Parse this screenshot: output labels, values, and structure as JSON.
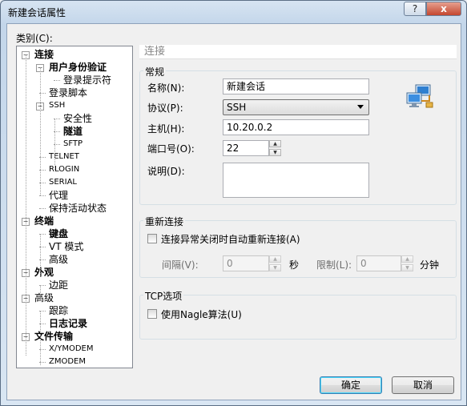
{
  "window": {
    "title": "新建会话属性",
    "help_btn": "?",
    "close_btn": "x"
  },
  "category_label": "类别(C):",
  "tree": [
    {
      "label": "连接",
      "bold": true,
      "expander": "−"
    },
    {
      "label": "用户身份验证",
      "bold": true,
      "expander": "−"
    },
    {
      "label": "登录提示符"
    },
    {
      "label": "登录脚本"
    },
    {
      "label": "SSH",
      "expander": "−",
      "small": true
    },
    {
      "label": "安全性"
    },
    {
      "label": "隧道",
      "bold": true
    },
    {
      "label": "SFTP",
      "small": true
    },
    {
      "label": "TELNET",
      "small": true
    },
    {
      "label": "RLOGIN",
      "small": true
    },
    {
      "label": "SERIAL",
      "small": true
    },
    {
      "label": "代理"
    },
    {
      "label": "保持活动状态"
    },
    {
      "label": "终端",
      "bold": true,
      "expander": "−"
    },
    {
      "label": "键盘",
      "bold": true
    },
    {
      "label": "VT 模式"
    },
    {
      "label": "高级"
    },
    {
      "label": "外观",
      "bold": true,
      "expander": "−"
    },
    {
      "label": "边距"
    },
    {
      "label": "高级",
      "expander": "−"
    },
    {
      "label": "跟踪"
    },
    {
      "label": "日志记录",
      "bold": true
    },
    {
      "label": "文件传输",
      "bold": true,
      "expander": "−"
    },
    {
      "label": "X/YMODEM",
      "small": true
    },
    {
      "label": "ZMODEM",
      "small": true
    }
  ],
  "panel": {
    "header": "连接",
    "general": {
      "title": "常规",
      "name_label": "名称(N):",
      "name_value": "新建会话",
      "protocol_label": "协议(P):",
      "protocol_value": "SSH",
      "host_label": "主机(H):",
      "host_value": "10.20.0.2",
      "port_label": "端口号(O):",
      "port_value": "22",
      "desc_label": "说明(D):",
      "desc_value": ""
    },
    "reconnect": {
      "title": "重新连接",
      "checkbox_label": "连接异常关闭时自动重新连接(A)",
      "interval_label": "间隔(V):",
      "interval_value": "0",
      "interval_unit": "秒",
      "limit_label": "限制(L):",
      "limit_value": "0",
      "limit_unit": "分钟"
    },
    "tcp": {
      "title": "TCP选项",
      "checkbox_label": "使用Nagle算法(U)"
    }
  },
  "buttons": {
    "ok": "确定",
    "cancel": "取消"
  }
}
